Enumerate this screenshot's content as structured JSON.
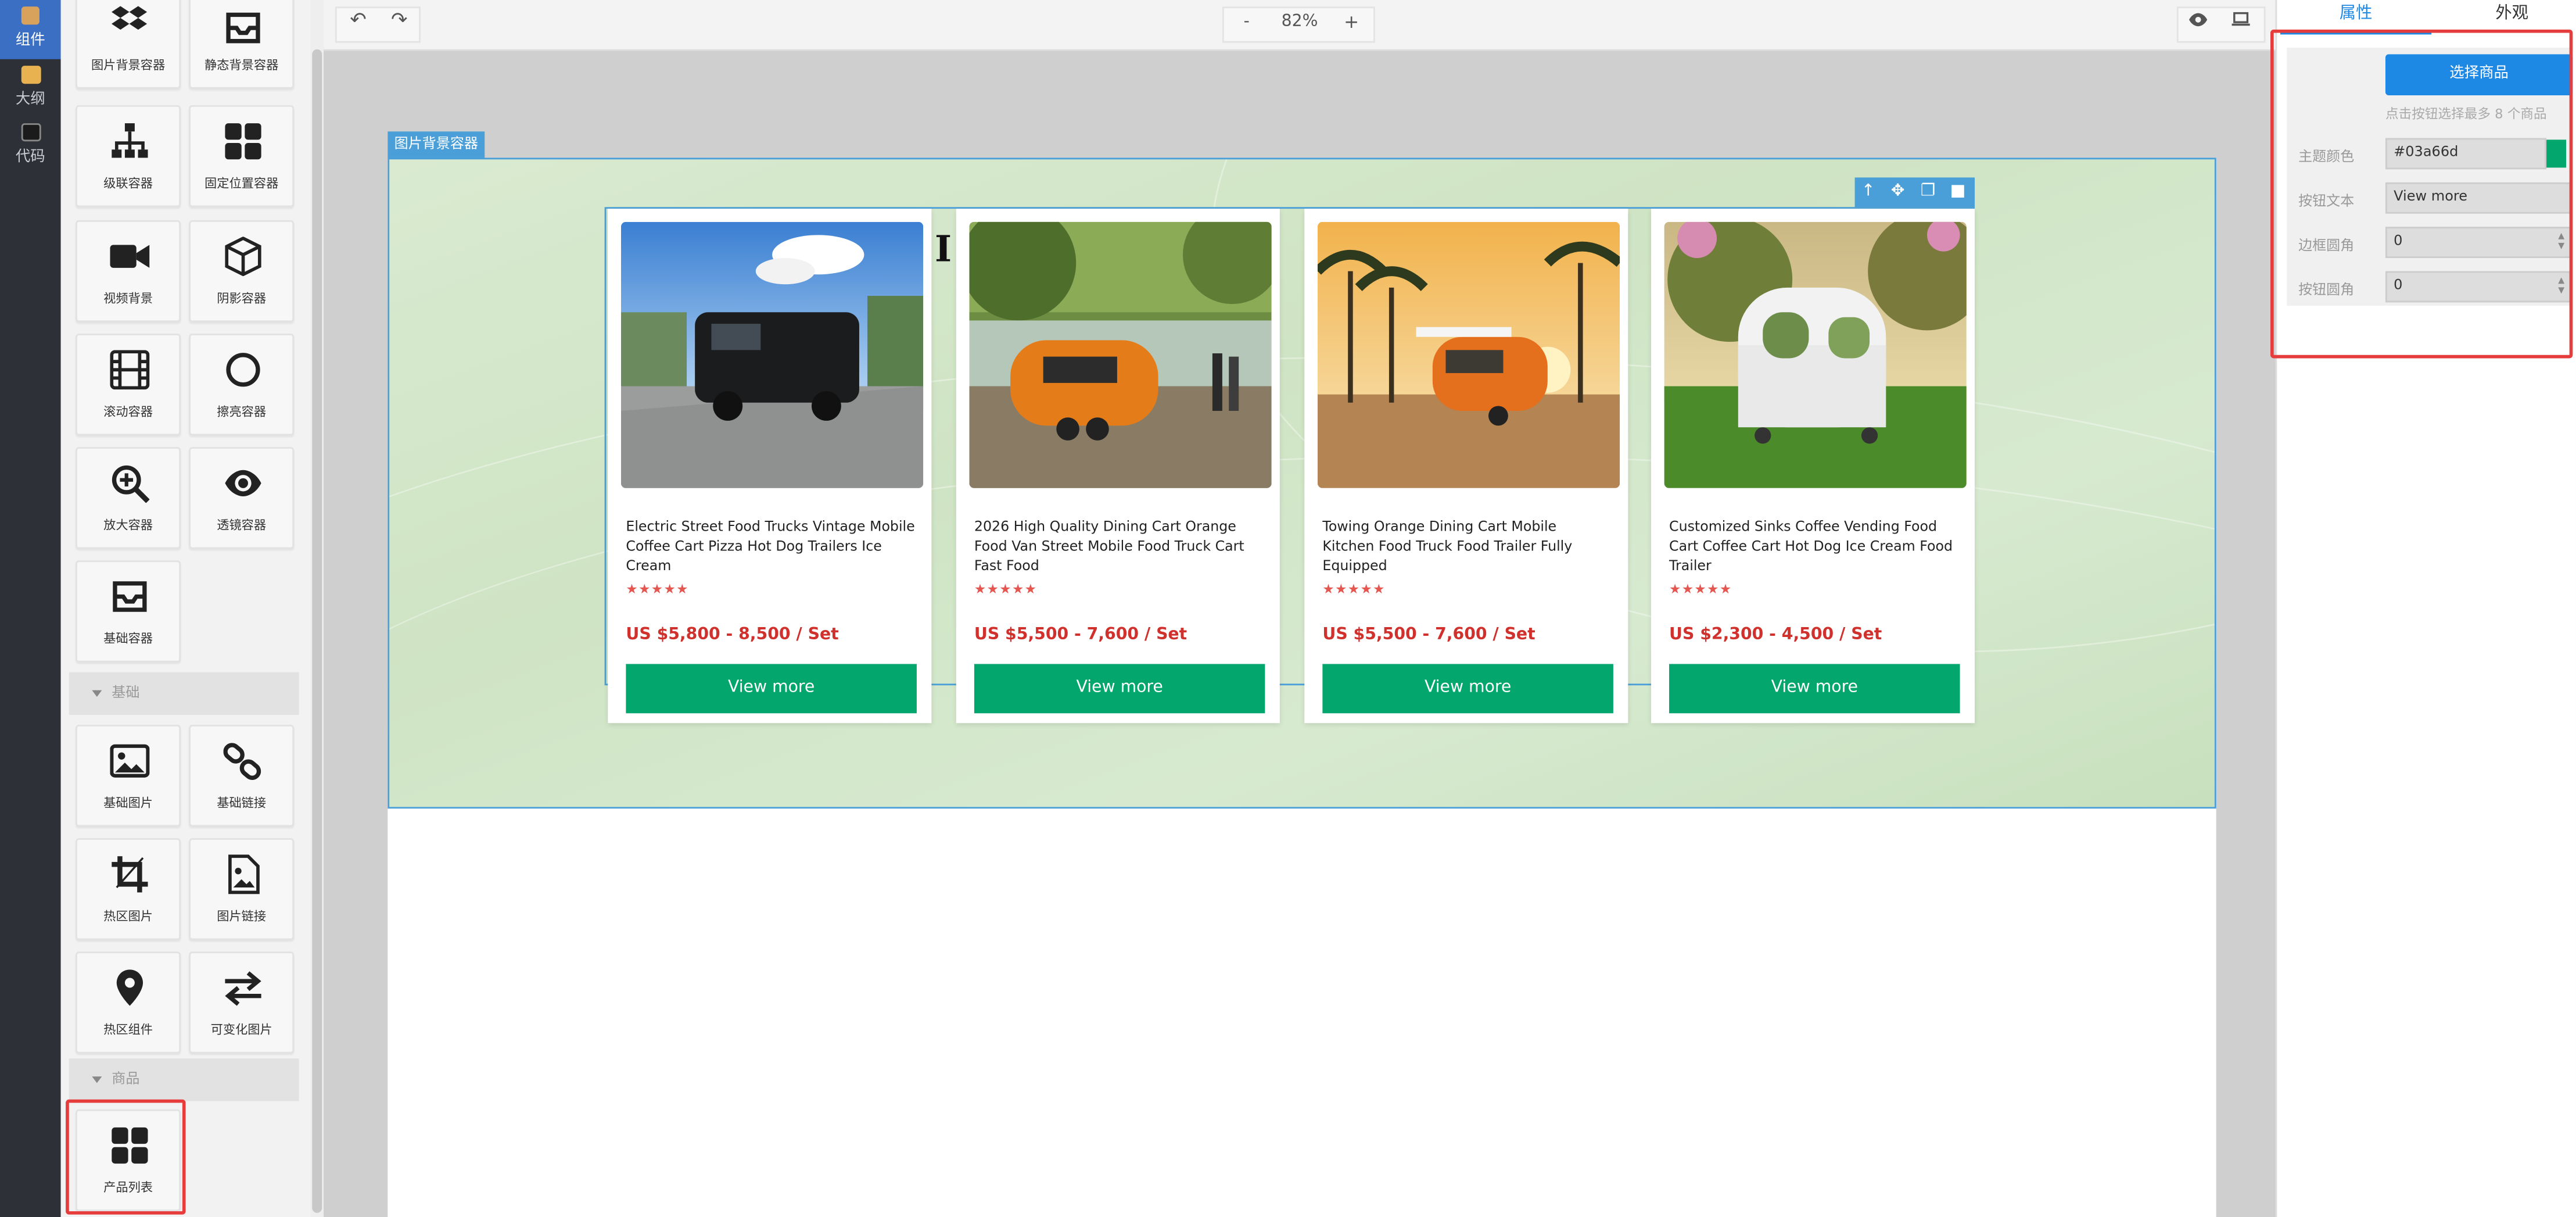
{
  "rail": {
    "items": [
      {
        "label": "组件",
        "icon": "box-icon"
      },
      {
        "label": "大纲",
        "icon": "folder-icon"
      },
      {
        "label": "代码",
        "icon": "monitor-icon"
      }
    ]
  },
  "panel": {
    "tiles": [
      {
        "label": "图片背景容器",
        "icon": "dropbox-icon"
      },
      {
        "label": "静态背景容器",
        "icon": "inbox-icon"
      },
      {
        "label": "级联容器",
        "icon": "sitemap-icon"
      },
      {
        "label": "固定位置容器",
        "icon": "grid-icon"
      },
      {
        "label": "视频背景",
        "icon": "video-icon"
      },
      {
        "label": "阴影容器",
        "icon": "cube-icon"
      },
      {
        "label": "滚动容器",
        "icon": "film-icon"
      },
      {
        "label": "擦亮容器",
        "icon": "circle-icon"
      },
      {
        "label": "放大容器",
        "icon": "zoom-in-icon"
      },
      {
        "label": "透镜容器",
        "icon": "eye-icon"
      },
      {
        "label": "基础容器",
        "icon": "inbox-icon"
      }
    ],
    "section_basic": "基础",
    "basic_tiles": [
      {
        "label": "基础图片",
        "icon": "image-icon"
      },
      {
        "label": "基础链接",
        "icon": "link-icon"
      },
      {
        "label": "热区图片",
        "icon": "crop-icon"
      },
      {
        "label": "图片链接",
        "icon": "image-file-icon"
      },
      {
        "label": "热区组件",
        "icon": "map-pin-icon"
      },
      {
        "label": "可变化图片",
        "icon": "exchange-icon"
      }
    ],
    "section_goods": "商品",
    "goods_tiles": [
      {
        "label": "产品列表",
        "icon": "grid-icon"
      }
    ]
  },
  "topbar": {
    "undo": "↶",
    "redo": "↷",
    "zoom_minus": "-",
    "zoom_value": "82%",
    "zoom_plus": "+"
  },
  "canvas": {
    "container_tag": "图片背景容器",
    "cursor_glyph": "I",
    "theme_color": "#03a66d",
    "products": [
      {
        "title": "Electric Street Food Trucks Vintage Mobile Coffee Cart Pizza Hot Dog Trailers Ice Cream",
        "stars": "★★★★★",
        "price": "US $5,800 - 8,500 / Set",
        "button": "View more"
      },
      {
        "title": "2026 High Quality Dining Cart Orange Food Van Street Mobile Food Truck Cart Fast Food",
        "stars": "★★★★★",
        "price": "US $5,500 - 7,600 / Set",
        "button": "View more"
      },
      {
        "title": "Towing Orange Dining Cart Mobile Kitchen Food Truck Food Trailer Fully Equipped",
        "stars": "★★★★★",
        "price": "US $5,500 - 7,600 / Set",
        "button": "View more"
      },
      {
        "title": "Customized Sinks Coffee Vending Food Cart Coffee Cart Hot Dog Ice Cream Food Trailer",
        "stars": "★★★★★",
        "price": "US $2,300 - 4,500 / Set",
        "button": "View more"
      }
    ]
  },
  "rpanel": {
    "tab_props": "属性",
    "tab_appearance": "外观",
    "select_button": "选择商品",
    "hint": "点击按钮选择最多 8 个商品",
    "fields": [
      {
        "label": "主题颜色",
        "value": "#03a66d"
      },
      {
        "label": "按钮文本",
        "value": "View more"
      },
      {
        "label": "边框圆角",
        "value": "0"
      },
      {
        "label": "按钮圆角",
        "value": "0"
      }
    ]
  }
}
